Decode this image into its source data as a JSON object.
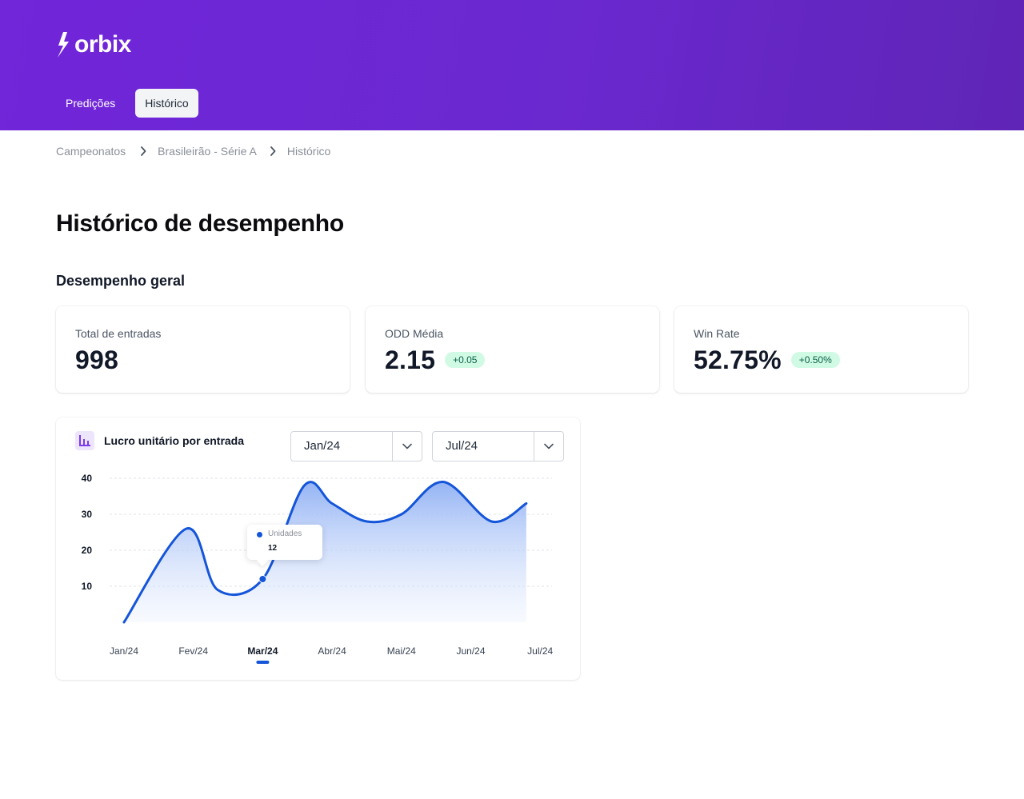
{
  "brand": {
    "name": "orbix"
  },
  "nav": {
    "tabs": [
      {
        "label": "Predições"
      },
      {
        "label": "Histórico"
      }
    ]
  },
  "breadcrumb": {
    "items": [
      "Campeonatos",
      "Brasileirão - Série A",
      "Histórico"
    ]
  },
  "page": {
    "title": "Histórico de desempenho",
    "section_title": "Desempenho geral"
  },
  "stats": [
    {
      "label": "Total de entradas",
      "value": "998"
    },
    {
      "label": "ODD Média",
      "value": "2.15",
      "badge": "+0.05"
    },
    {
      "label": "Win Rate",
      "value": "52.75%",
      "badge": "+0.50%"
    }
  ],
  "chart_card": {
    "title": "Lucro unitário por entrada",
    "icon": "bar-chart-icon",
    "from_select": {
      "value": "Jan/24"
    },
    "to_select": {
      "value": "Jul/24"
    },
    "tooltip": {
      "label": "Unidades",
      "value": "12"
    }
  },
  "colors": {
    "header": "#6a28cf",
    "line": "#1455d9",
    "badge_bg": "#d1fae5",
    "badge_text": "#065f46"
  },
  "chart_data": {
    "type": "area",
    "title": "Lucro unitário por entrada",
    "categories": [
      "Jan/24",
      "Fev/24",
      "Mar/24",
      "Abr/24",
      "Mai/24",
      "Jun/24",
      "Jul/24"
    ],
    "active_category": "Mar/24",
    "yticks": [
      10,
      20,
      30,
      40
    ],
    "ylim": [
      0,
      40
    ],
    "grid": true,
    "series": [
      {
        "x": [
          0,
          0.9,
          1.35,
          2.0,
          2.6,
          3.0,
          3.5,
          4.0,
          4.6,
          5.3,
          5.8
        ],
        "y": [
          0,
          26,
          9,
          12,
          38,
          33,
          28,
          30,
          39,
          28,
          33
        ]
      }
    ],
    "highlight": {
      "x": 2.0,
      "y": 12
    }
  }
}
